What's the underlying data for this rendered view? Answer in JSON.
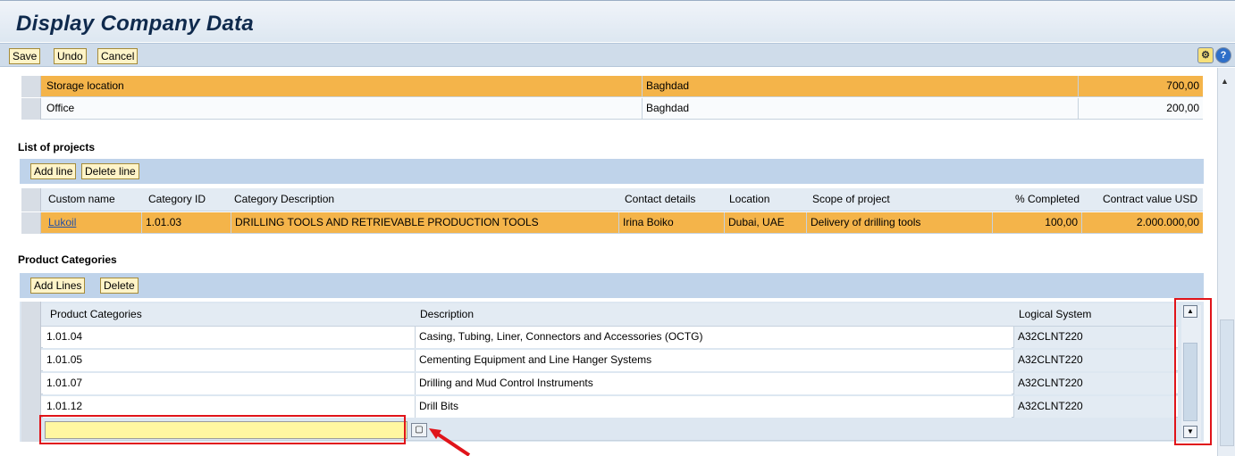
{
  "app": {
    "title": "Display Company Data"
  },
  "toolbar": {
    "save": "Save",
    "undo": "Undo",
    "cancel": "Cancel"
  },
  "locations": {
    "rows": [
      {
        "type": "Storage location",
        "city": "Baghdad",
        "value": "700,00",
        "highlighted": true
      },
      {
        "type": "Office",
        "city": "Baghdad",
        "value": "200,00",
        "highlighted": false
      }
    ]
  },
  "projects": {
    "title": "List of projects",
    "add": "Add line",
    "delete": "Delete line",
    "headers": [
      "Custom name",
      "Category ID",
      "Category Description",
      "Contact details",
      "Location",
      "Scope of project",
      "% Completed",
      "Contract value USD"
    ],
    "rows": [
      [
        "Lukoil",
        "1.01.03",
        "DRILLING TOOLS AND RETRIEVABLE PRODUCTION TOOLS",
        "Irina Boiko",
        "Dubai, UAE",
        "Delivery of drilling tools",
        "100,00",
        "2.000.000,00"
      ]
    ]
  },
  "products": {
    "title": "Product Categories",
    "add": "Add Lines",
    "delete": "Delete",
    "headers": [
      "Product Categories",
      "Description",
      "Logical System"
    ],
    "rows": [
      [
        "1.01.04",
        "Casing, Tubing, Liner, Connectors and Accessories (OCTG)",
        "A32CLNT220"
      ],
      [
        "1.01.05",
        "Cementing Equipment and Line Hanger Systems",
        "A32CLNT220"
      ],
      [
        "1.01.07",
        "Drilling and Mud Control Instruments",
        "A32CLNT220"
      ],
      [
        "1.01.12",
        "Drill Bits",
        "A32CLNT220"
      ]
    ],
    "new_row_value": ""
  },
  "colors": {
    "highlight_row": "#f4b44a",
    "input_highlight": "#fff7a1",
    "annotation": "#e0141a"
  }
}
